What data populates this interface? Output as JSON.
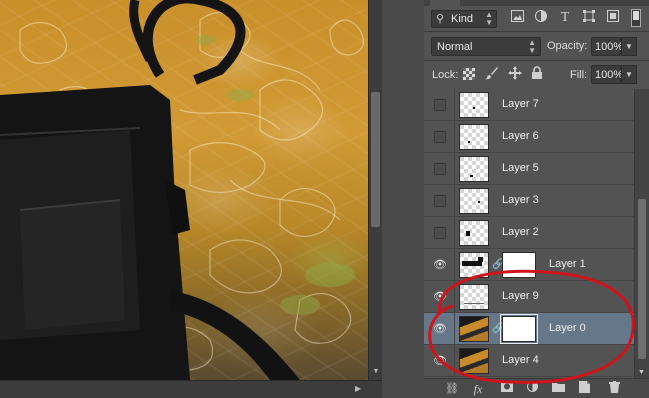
{
  "panel": {
    "filter": {
      "kind_label": "Kind",
      "icons": [
        "pixel-filter-icon",
        "adjustment-filter-icon",
        "type-filter-icon",
        "shape-filter-icon",
        "smart-object-filter-icon"
      ],
      "type_glyph": "T"
    },
    "blend_mode": "Normal",
    "opacity_label": "Opacity:",
    "opacity_value": "100%",
    "lock_label": "Lock:",
    "fill_label": "Fill:",
    "fill_value": "100%"
  },
  "layers": [
    {
      "name": "Layer 7",
      "visible": false
    },
    {
      "name": "Layer 6",
      "visible": false
    },
    {
      "name": "Layer 5",
      "visible": false
    },
    {
      "name": "Layer 3",
      "visible": false
    },
    {
      "name": "Layer 2",
      "visible": false
    },
    {
      "name": "Layer 1",
      "visible": true,
      "has_mask": true
    },
    {
      "name": "Layer 9",
      "visible": true
    },
    {
      "name": "Layer 0",
      "visible": true,
      "has_mask": true,
      "selected": true
    },
    {
      "name": "Layer 4",
      "visible": true
    }
  ],
  "bottom_bar": {
    "fx_label": "fx"
  },
  "colors": {
    "annotation": "#d0141b",
    "selected_row": "#667789",
    "panel_bg": "#535353"
  }
}
